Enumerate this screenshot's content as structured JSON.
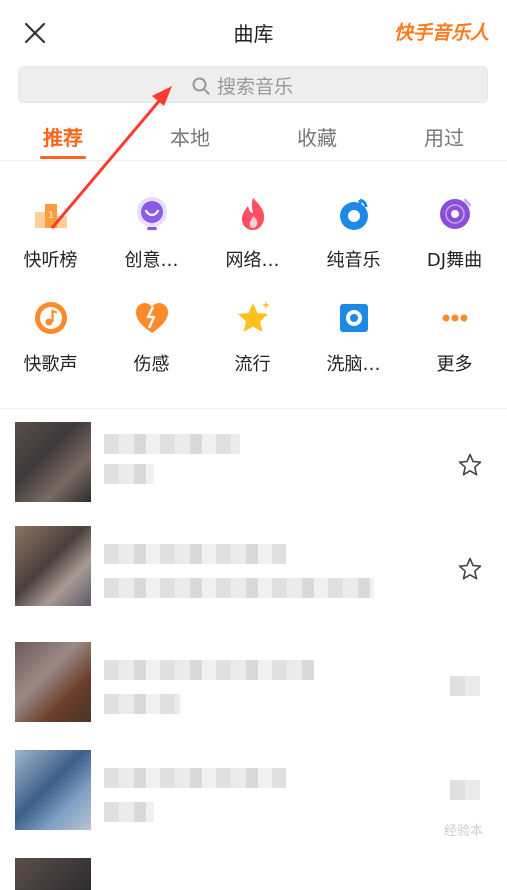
{
  "header": {
    "title": "曲库",
    "brand": "快手音乐人"
  },
  "search": {
    "placeholder": "搜索音乐"
  },
  "tabs": [
    {
      "label": "推荐",
      "active": true
    },
    {
      "label": "本地",
      "active": false
    },
    {
      "label": "收藏",
      "active": false
    },
    {
      "label": "用过",
      "active": false
    }
  ],
  "categories": [
    {
      "label": "快听榜",
      "icon": "podium-icon"
    },
    {
      "label": "创意…",
      "icon": "creative-bulb-icon"
    },
    {
      "label": "网络…",
      "icon": "flame-icon"
    },
    {
      "label": "纯音乐",
      "icon": "drop-music-icon"
    },
    {
      "label": "DJ舞曲",
      "icon": "vinyl-icon"
    },
    {
      "label": "快歌声",
      "icon": "music-note-icon"
    },
    {
      "label": "伤感",
      "icon": "broken-heart-icon"
    },
    {
      "label": "流行",
      "icon": "star-icon"
    },
    {
      "label": "洗脑…",
      "icon": "square-target-icon"
    },
    {
      "label": "更多",
      "icon": "more-dots-icon"
    }
  ],
  "watermark": "经验本",
  "colors": {
    "accent": "#ff6419",
    "brand": "#ff7a1f"
  }
}
